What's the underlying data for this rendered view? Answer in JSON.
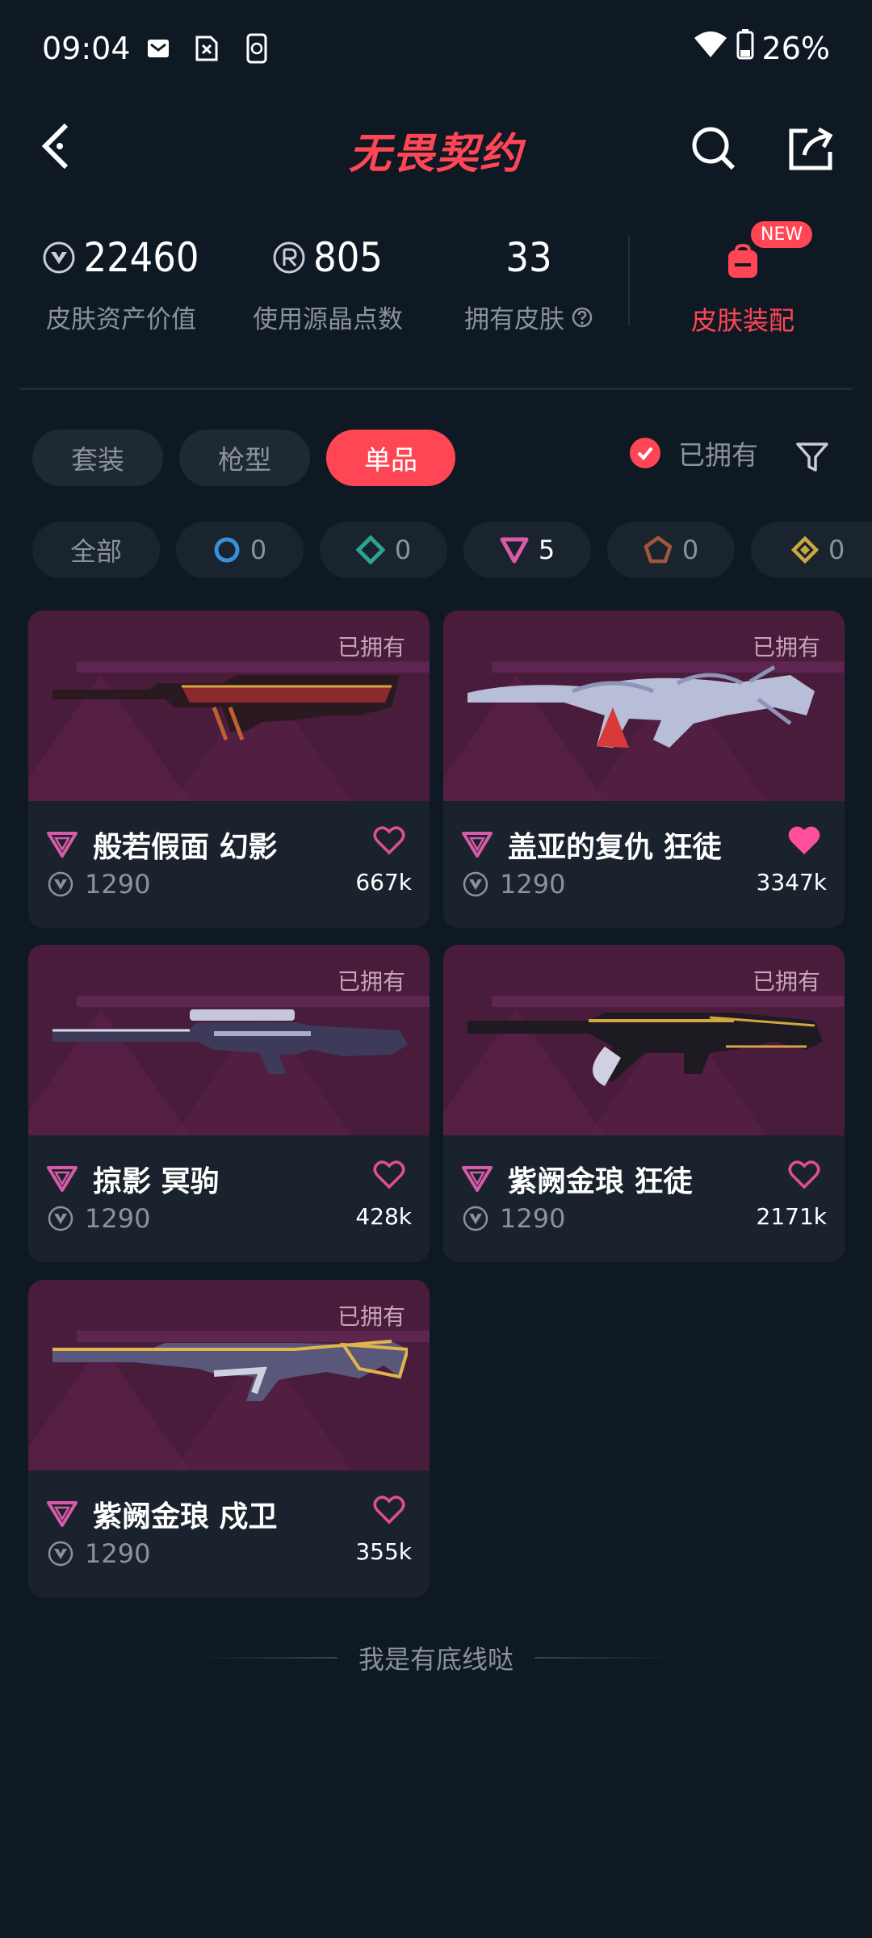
{
  "status": {
    "time": "09:04",
    "battery": "26%"
  },
  "header": {
    "title": "无畏契约"
  },
  "stats": [
    {
      "value": "22460",
      "label": "皮肤资产价值",
      "icon": "vp-icon"
    },
    {
      "value": "805",
      "label": "使用源晶点数",
      "icon": "radianite-icon"
    },
    {
      "value": "33",
      "label": "拥有皮肤",
      "icon": "help-icon"
    }
  ],
  "assemble": {
    "label": "皮肤装配",
    "badge": "NEW"
  },
  "tabs": [
    {
      "label": "套装",
      "active": false
    },
    {
      "label": "枪型",
      "active": false
    },
    {
      "label": "单品",
      "active": true
    }
  ],
  "owned_filter": {
    "label": "已拥有",
    "checked": true
  },
  "tiers": [
    {
      "label": "全部"
    },
    {
      "icon": "select-tier-icon",
      "count": "0",
      "color": "#3a8fd8"
    },
    {
      "icon": "deluxe-tier-icon",
      "count": "0",
      "color": "#2aa58f"
    },
    {
      "icon": "premium-tier-icon",
      "count": "5",
      "color": "#d95aa8"
    },
    {
      "icon": "exclusive-tier-icon",
      "count": "0",
      "color": "#d27a4a"
    },
    {
      "icon": "ultra-tier-icon",
      "count": "0",
      "color": "#e6c14a"
    }
  ],
  "skins": [
    {
      "name": "般若假面 幻影",
      "price": "1290",
      "likes": "667k",
      "tag": "已拥有",
      "liked": false
    },
    {
      "name": "盖亚的复仇 狂徒",
      "price": "1290",
      "likes": "3347k",
      "tag": "已拥有",
      "liked": true
    },
    {
      "name": "掠影 冥驹",
      "price": "1290",
      "likes": "428k",
      "tag": "已拥有",
      "liked": false
    },
    {
      "name": "紫阙金琅 狂徒",
      "price": "1290",
      "likes": "2171k",
      "tag": "已拥有",
      "liked": false
    },
    {
      "name": "紫阙金琅 戍卫",
      "price": "1290",
      "likes": "355k",
      "tag": "已拥有",
      "liked": false
    }
  ],
  "footer": {
    "text": "我是有底线哒"
  },
  "colors": {
    "accent": "#ff4655",
    "background": "#0f1923",
    "card": "#1a232d",
    "card_art": "#4a1c3c"
  }
}
